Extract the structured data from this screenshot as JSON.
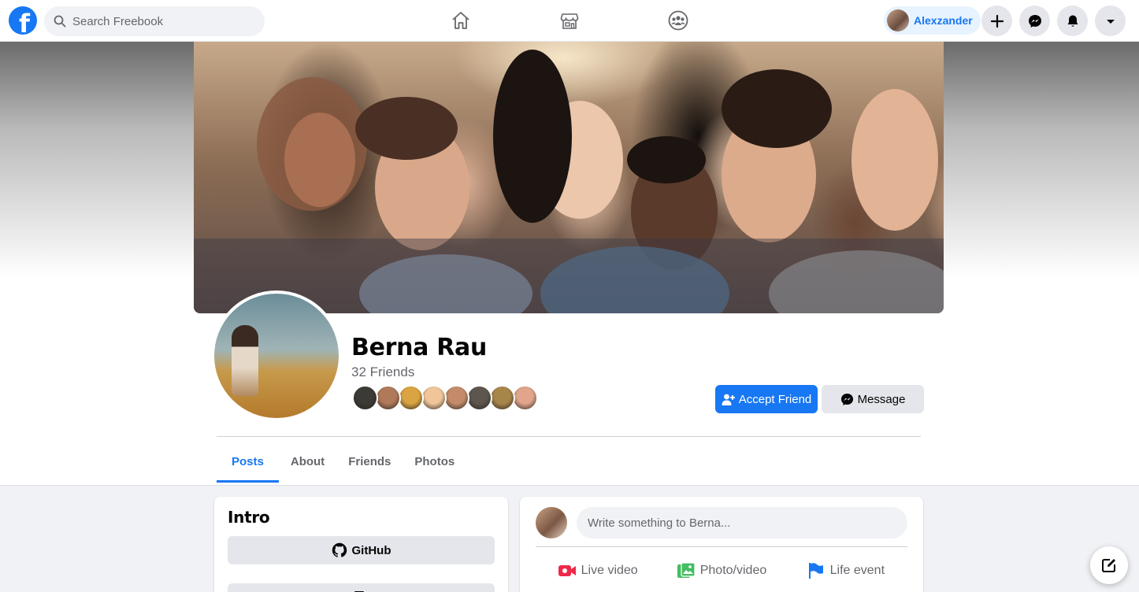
{
  "app": {
    "logo_icon": "facebook-logo-icon",
    "brand_color": "#1877f2"
  },
  "topbar": {
    "search": {
      "placeholder": "Search Freebook",
      "value": ""
    },
    "nav_icons": [
      "home-icon",
      "marketplace-icon",
      "groups-icon"
    ],
    "user_name": "Alexzander",
    "actions": [
      "plus-icon",
      "messenger-icon",
      "bell-icon",
      "caret-down-icon"
    ]
  },
  "profile": {
    "name": "Berna Rau",
    "friends_count": "32 Friends",
    "friend_avatar_colors": [
      "#3c3a36",
      "#b07a5a",
      "#d9a441",
      "#f0c59a",
      "#c48b6a",
      "#5d564e",
      "#a8864a",
      "#e0a58a"
    ],
    "accept_label": "Accept Friend",
    "message_label": "Message"
  },
  "tabs": [
    {
      "label": "Posts",
      "active": true
    },
    {
      "label": "About",
      "active": false
    },
    {
      "label": "Friends",
      "active": false
    },
    {
      "label": "Photos",
      "active": false
    }
  ],
  "intro": {
    "title": "Intro",
    "github_label": "GitHub"
  },
  "composer": {
    "placeholder": "Write something to Berna...",
    "actions": [
      {
        "label": "Live video",
        "icon": "live-video-icon",
        "color": "#f02849"
      },
      {
        "label": "Photo/video",
        "icon": "photo-video-icon",
        "color": "#45bd62"
      },
      {
        "label": "Life event",
        "icon": "flag-icon",
        "color": "#1877f2"
      }
    ]
  }
}
